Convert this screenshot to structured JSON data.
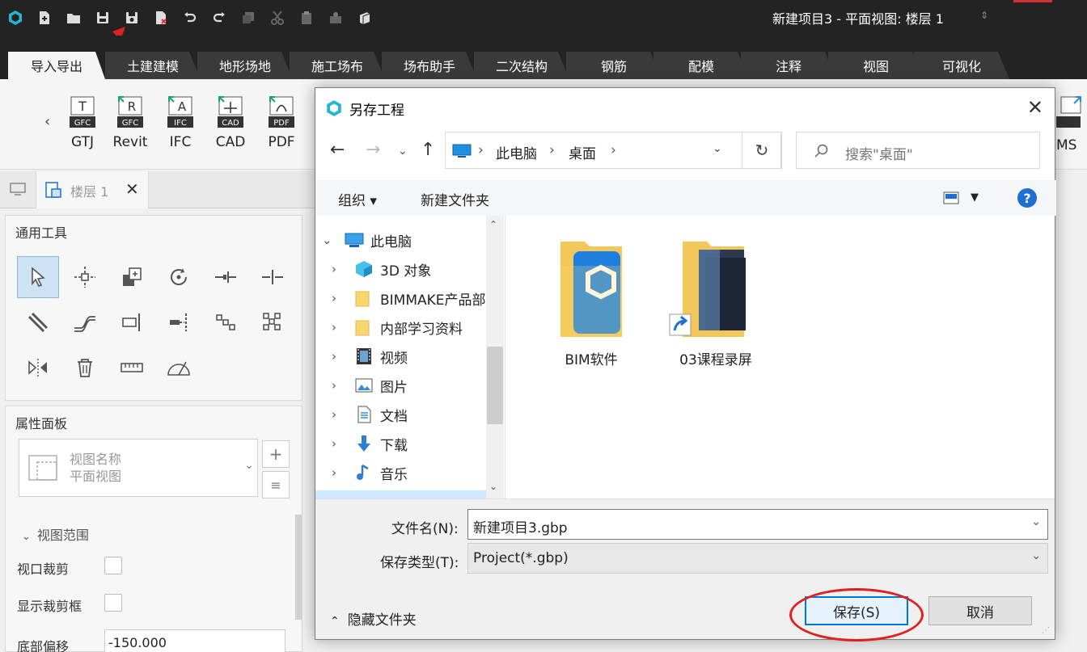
{
  "app": {
    "title": "新建项目3 - 平面视图: 楼层 1",
    "title_switch_icon": "updown-caret-icon"
  },
  "quick_access": [
    "app-logo-icon",
    "new-icon",
    "open-icon",
    "save-icon",
    "save-as-icon",
    "close-file-icon",
    "undo-icon",
    "redo-icon",
    "copy-icon",
    "cut-icon",
    "paste-icon",
    "match-icon",
    "box-icon"
  ],
  "ribbon_tabs": [
    "导入导出",
    "土建建模",
    "地形场地",
    "施工场布",
    "场布助手",
    "二次结构",
    "钢筋",
    "配模",
    "注释",
    "视图",
    "可视化"
  ],
  "ribbon_buttons": [
    {
      "label": "GTJ",
      "icon_text": "GFC"
    },
    {
      "label": "Revit",
      "icon_text": "GFC"
    },
    {
      "label": "IFC",
      "icon_text": "IFC"
    },
    {
      "label": "CAD",
      "icon_text": "CAD"
    },
    {
      "label": "PDF",
      "icon_text": "PDF"
    }
  ],
  "ribbon_right_label": "MS",
  "doc_tab": {
    "label": "楼层 1",
    "close": "✕"
  },
  "tools_panel": {
    "title": "通用工具"
  },
  "props_panel": {
    "title": "属性面板",
    "view_name_label": "视图名称",
    "view_name_value": "平面视图",
    "section": "视图范围",
    "rows": [
      {
        "label": "视口裁剪"
      },
      {
        "label": "显示裁剪框"
      },
      {
        "label": "底部偏移",
        "value": "-150.000"
      }
    ]
  },
  "dialog": {
    "title": "另存工程",
    "close": "✕",
    "address": [
      "此电脑",
      "桌面"
    ],
    "search_placeholder": "搜索\"桌面\"",
    "organize": "组织 ▾",
    "new_folder": "新建文件夹",
    "help": "?",
    "tree": [
      {
        "label": "此电脑",
        "icon": "computer-icon",
        "expanded": true
      },
      {
        "label": "3D 对象",
        "icon": "cube-3d-icon"
      },
      {
        "label": "BIMMAKE产品部",
        "icon": "folder-icon"
      },
      {
        "label": "内部学习资料",
        "icon": "folder-icon"
      },
      {
        "label": "视频",
        "icon": "video-icon"
      },
      {
        "label": "图片",
        "icon": "pictures-icon"
      },
      {
        "label": "文档",
        "icon": "documents-icon"
      },
      {
        "label": "下载",
        "icon": "download-icon"
      },
      {
        "label": "音乐",
        "icon": "music-icon"
      }
    ],
    "files": [
      {
        "name": "BIM软件",
        "icon": "folder-with-bim-icon"
      },
      {
        "name": "03课程录屏",
        "icon": "folder-shortcut-icon"
      }
    ],
    "file_name_label": "文件名(N):",
    "file_name_value": "新建项目3.gbp",
    "file_type_label": "保存类型(T):",
    "file_type_value": "Project(*.gbp)",
    "hide_folders": "隐藏文件夹",
    "save": "保存(S)",
    "cancel": "取消"
  },
  "colors": {
    "annotation_red": "#e02020",
    "accent_blue": "#0078d7",
    "ribbon_dark": "#232323"
  }
}
